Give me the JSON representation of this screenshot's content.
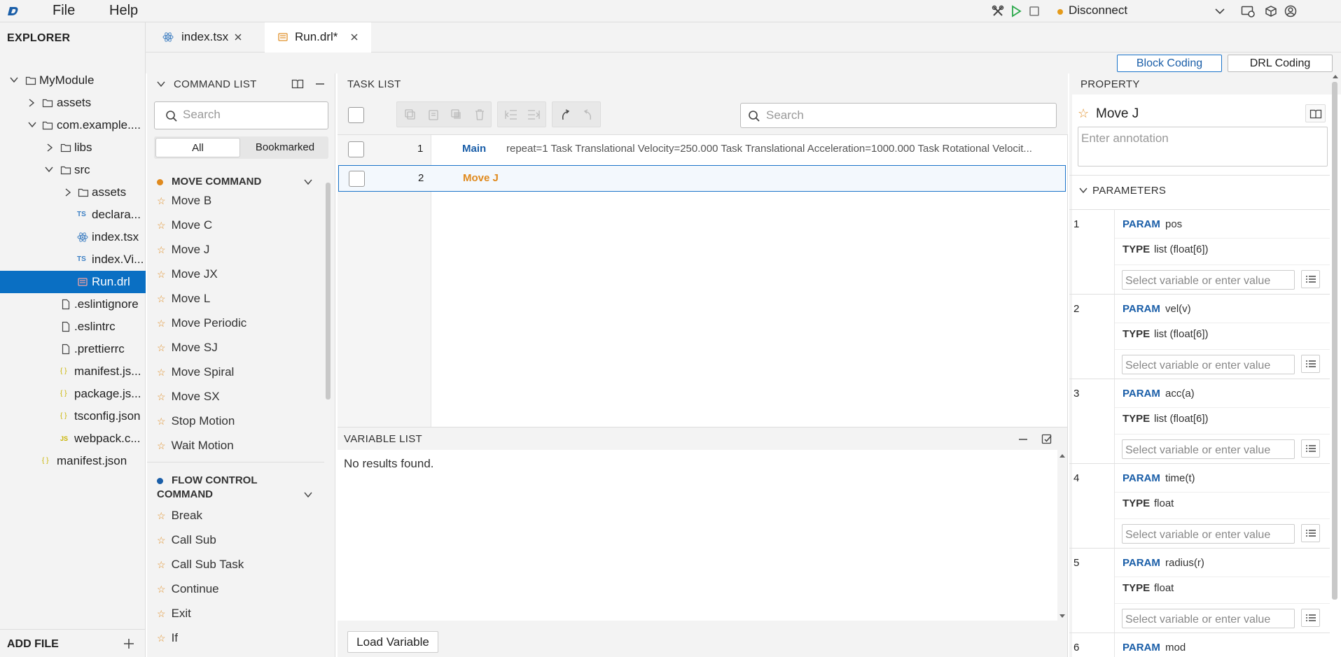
{
  "menu": {
    "file": "File",
    "help": "Help"
  },
  "connection": {
    "status": "Disconnect",
    "status_color": "#e59b1a"
  },
  "explorer": {
    "title": "EXPLORER",
    "add_file": "ADD FILE",
    "items": [
      {
        "label": "MyModule"
      },
      {
        "label": "assets"
      },
      {
        "label": "com.example...."
      },
      {
        "label": "libs"
      },
      {
        "label": "src"
      },
      {
        "label": "assets"
      },
      {
        "label": "declara..."
      },
      {
        "label": "index.tsx"
      },
      {
        "label": "index.Vi..."
      },
      {
        "label": "Run.drl"
      },
      {
        "label": ".eslintignore"
      },
      {
        "label": ".eslintrc"
      },
      {
        "label": ".prettierrc"
      },
      {
        "label": "manifest.js..."
      },
      {
        "label": "package.js..."
      },
      {
        "label": "tsconfig.json"
      },
      {
        "label": "webpack.c..."
      },
      {
        "label": "manifest.json"
      }
    ],
    "icon_labels": {
      "ts": "TS",
      "js": "JS",
      "json": "{ }"
    }
  },
  "tabs": [
    {
      "label": "index.tsx"
    },
    {
      "label": "Run.drl*"
    }
  ],
  "modes": {
    "block": "Block Coding",
    "drl": "DRL Coding"
  },
  "command_list": {
    "title": "COMMAND LIST",
    "search_placeholder": "Search",
    "filter_all": "All",
    "filter_bookmarked": "Bookmarked",
    "groups": [
      {
        "title": "MOVE COMMAND",
        "color": "#e08a1e",
        "items": [
          "Move B",
          "Move C",
          "Move J",
          "Move JX",
          "Move L",
          "Move Periodic",
          "Move SJ",
          "Move Spiral",
          "Move SX",
          "Stop Motion",
          "Wait Motion"
        ]
      },
      {
        "title": "FLOW CONTROL COMMAND",
        "title_line1": "FLOW CONTROL",
        "title_line2": "COMMAND",
        "color": "#1a5ea8",
        "items": [
          "Break",
          "Call Sub",
          "Call Sub Task",
          "Continue",
          "Exit",
          "If"
        ]
      }
    ]
  },
  "task_list": {
    "title": "TASK LIST",
    "search_placeholder": "Search",
    "rows": [
      {
        "num": "1",
        "name": "Main",
        "name_color": "#1a5ea8",
        "detail": "repeat=1 Task Translational Velocity=250.000 Task Translational Acceleration=1000.000 Task Rotational Velocit..."
      },
      {
        "num": "2",
        "name": "Move J",
        "name_color": "#e08a1e",
        "detail": ""
      }
    ]
  },
  "variable_list": {
    "title": "VARIABLE LIST",
    "empty": "No results found.",
    "load_button": "Load Variable"
  },
  "property": {
    "title": "PROPERTY",
    "command": "Move J",
    "annotation_placeholder": "Enter annotation",
    "parameters_title": "PARAMETERS",
    "param_key": "PARAM",
    "type_key": "TYPE",
    "input_placeholder": "Select variable or enter value",
    "params": [
      {
        "num": "1",
        "name": "pos",
        "type": "list (float[6])"
      },
      {
        "num": "2",
        "name": "vel(v)",
        "type": "list (float[6])"
      },
      {
        "num": "3",
        "name": "acc(a)",
        "type": "list (float[6])"
      },
      {
        "num": "4",
        "name": "time(t)",
        "type": "float"
      },
      {
        "num": "5",
        "name": "radius(r)",
        "type": "float"
      },
      {
        "num": "6",
        "name": "mod",
        "type": ""
      }
    ]
  }
}
